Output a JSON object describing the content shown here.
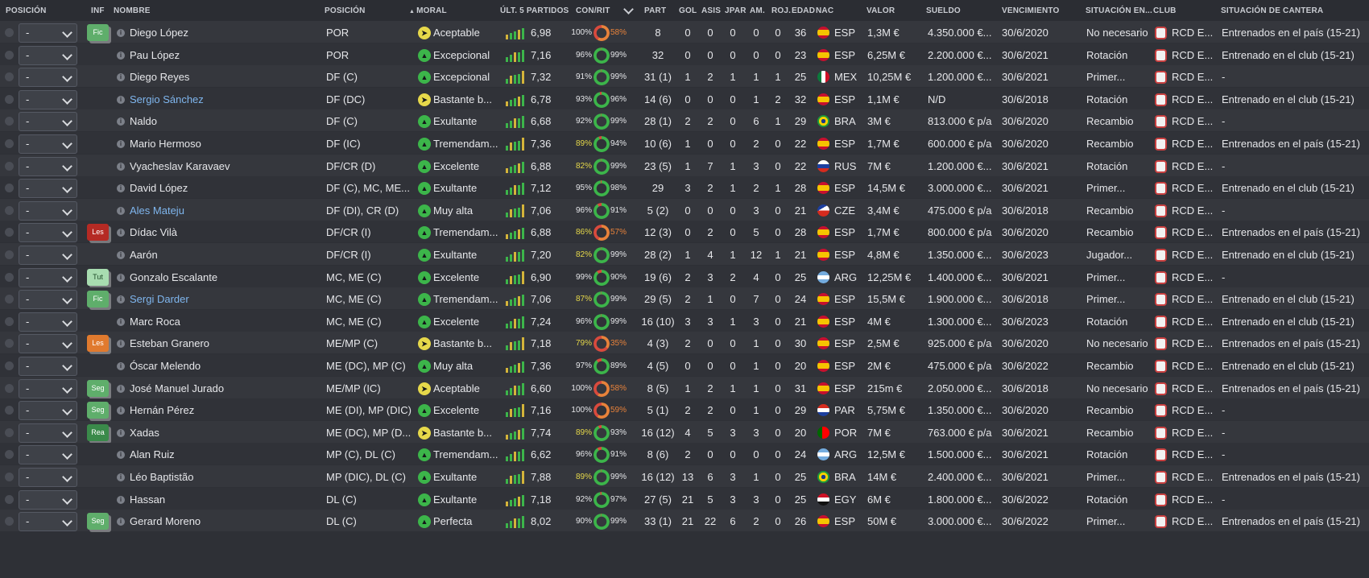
{
  "headers": {
    "posicion": "POSICIÓN",
    "inf": "INF",
    "nombre": "NOMBRE",
    "posicion2": "POSICIÓN",
    "moral": "MORAL",
    "ult5": "ÚLT. 5 PARTIDOS",
    "conrit": "CON/RIT",
    "part": "PART",
    "gol": "GOL",
    "asis": "ASIS",
    "jpar": "JPAR",
    "am": "AM.",
    "roj": "ROJ.",
    "edad": "EDAD",
    "nac": "NAC",
    "valor": "VALOR",
    "sueldo": "SUELDO",
    "vencimiento": "VENCIMIENTO",
    "situacion": "SITUACIÓN EN...",
    "club": "CLUB",
    "cantera": "SITUACIÓN DE CANTERA"
  },
  "colors": {
    "green": "#3cb54a",
    "orange": "#e8823a",
    "yellow": "#e6d84a",
    "red": "#d94a3d"
  },
  "players": [
    {
      "sel": "-",
      "badge": "Fic",
      "badge_color": "#5fae6b",
      "name": "Diego López",
      "link": false,
      "pos": "POR",
      "moral_icon": "yellow",
      "moral": "Aceptable",
      "avg": "6,98",
      "cond": "100%",
      "rit": "58%",
      "rit_color": "orange",
      "part": "8",
      "gol": "0",
      "asis": "0",
      "jpar": "0",
      "am": "0",
      "roj": "0",
      "edad": "36",
      "nac": "ESP",
      "valor": "1,3M €",
      "sueldo": "4.350.000 €...",
      "venc": "30/6/2020",
      "sit": "No necesario",
      "club": "RCD E...",
      "cantera": "Entrenados en el país (15-21)"
    },
    {
      "sel": "-",
      "badge": "",
      "badge_color": "",
      "name": "Pau López",
      "link": false,
      "pos": "POR",
      "moral_icon": "green",
      "moral": "Excepcional",
      "avg": "7,16",
      "cond": "96%",
      "rit": "99%",
      "rit_color": "green",
      "part": "32",
      "gol": "0",
      "asis": "0",
      "jpar": "0",
      "am": "0",
      "roj": "0",
      "edad": "23",
      "nac": "ESP",
      "valor": "6,25M €",
      "sueldo": "2.200.000 €...",
      "venc": "30/6/2021",
      "sit": "Rotación",
      "club": "RCD E...",
      "cantera": "Entrenado en el club (15-21)"
    },
    {
      "sel": "-",
      "badge": "",
      "badge_color": "",
      "name": "Diego Reyes",
      "link": false,
      "pos": "DF (C)",
      "moral_icon": "green",
      "moral": "Excepcional",
      "avg": "7,32",
      "cond": "91%",
      "rit": "99%",
      "rit_color": "green",
      "part": "31 (1)",
      "gol": "1",
      "asis": "2",
      "jpar": "1",
      "am": "1",
      "roj": "1",
      "edad": "25",
      "nac": "MEX",
      "valor": "10,25M €",
      "sueldo": "1.200.000 €...",
      "venc": "30/6/2021",
      "sit": "Primer...",
      "club": "RCD E...",
      "cantera": "-"
    },
    {
      "sel": "-",
      "badge": "",
      "badge_color": "",
      "name": "Sergio Sánchez",
      "link": true,
      "pos": "DF (DC)",
      "moral_icon": "yellow",
      "moral": "Bastante b...",
      "avg": "6,78",
      "cond": "93%",
      "rit": "96%",
      "rit_color": "green",
      "part": "14 (6)",
      "gol": "0",
      "asis": "0",
      "jpar": "0",
      "am": "1",
      "roj": "2",
      "edad": "32",
      "nac": "ESP",
      "valor": "1,1M €",
      "sueldo": "N/D",
      "venc": "30/6/2018",
      "sit": "Rotación",
      "club": "RCD E...",
      "cantera": "Entrenado en el club (15-21)"
    },
    {
      "sel": "-",
      "badge": "",
      "badge_color": "",
      "name": "Naldo",
      "link": false,
      "pos": "DF (C)",
      "moral_icon": "green",
      "moral": "Exultante",
      "avg": "6,68",
      "cond": "92%",
      "rit": "99%",
      "rit_color": "green",
      "part": "28 (1)",
      "gol": "2",
      "asis": "2",
      "jpar": "0",
      "am": "6",
      "roj": "1",
      "edad": "29",
      "nac": "BRA",
      "valor": "3M €",
      "sueldo": "813.000 € p/a",
      "venc": "30/6/2020",
      "sit": "Recambio",
      "club": "RCD E...",
      "cantera": "-"
    },
    {
      "sel": "-",
      "badge": "",
      "badge_color": "",
      "name": "Mario Hermoso",
      "link": false,
      "pos": "DF (IC)",
      "moral_icon": "green",
      "moral": "Tremendam...",
      "avg": "7,36",
      "cond": "89%",
      "rit": "94%",
      "rit_color": "green",
      "part": "10 (6)",
      "gol": "1",
      "asis": "0",
      "jpar": "0",
      "am": "2",
      "roj": "0",
      "edad": "22",
      "nac": "ESP",
      "valor": "1,7M €",
      "sueldo": "600.000 € p/a",
      "venc": "30/6/2020",
      "sit": "Recambio",
      "club": "RCD E...",
      "cantera": "Entrenados en el país (15-21)"
    },
    {
      "sel": "-",
      "badge": "",
      "badge_color": "",
      "name": "Vyacheslav Karavaev",
      "link": false,
      "pos": "DF/CR (D)",
      "moral_icon": "green",
      "moral": "Excelente",
      "avg": "6,88",
      "cond": "82%",
      "rit": "99%",
      "rit_color": "green",
      "part": "23 (5)",
      "gol": "1",
      "asis": "7",
      "jpar": "1",
      "am": "3",
      "roj": "0",
      "edad": "22",
      "nac": "RUS",
      "valor": "7M €",
      "sueldo": "1.200.000 €...",
      "venc": "30/6/2021",
      "sit": "Rotación",
      "club": "RCD E...",
      "cantera": "-"
    },
    {
      "sel": "-",
      "badge": "",
      "badge_color": "",
      "name": "David López",
      "link": false,
      "pos": "DF (C), MC, ME...",
      "moral_icon": "green",
      "moral": "Exultante",
      "avg": "7,12",
      "cond": "95%",
      "rit": "98%",
      "rit_color": "green",
      "part": "29",
      "gol": "3",
      "asis": "2",
      "jpar": "1",
      "am": "2",
      "roj": "1",
      "edad": "28",
      "nac": "ESP",
      "valor": "14,5M €",
      "sueldo": "3.000.000 €...",
      "venc": "30/6/2021",
      "sit": "Primer...",
      "club": "RCD E...",
      "cantera": "Entrenado en el club (15-21)"
    },
    {
      "sel": "-",
      "badge": "",
      "badge_color": "",
      "name": "Ales Mateju",
      "link": true,
      "pos": "DF (DI), CR (D)",
      "moral_icon": "green",
      "moral": "Muy alta",
      "avg": "7,06",
      "cond": "96%",
      "rit": "91%",
      "rit_color": "green",
      "part": "5 (2)",
      "gol": "0",
      "asis": "0",
      "jpar": "0",
      "am": "3",
      "roj": "0",
      "edad": "21",
      "nac": "CZE",
      "valor": "3,4M €",
      "sueldo": "475.000 € p/a",
      "venc": "30/6/2018",
      "sit": "Recambio",
      "club": "RCD E...",
      "cantera": "-"
    },
    {
      "sel": "-",
      "badge": "Les",
      "badge_color": "#b52a24",
      "name": "Dídac Vilà",
      "link": false,
      "pos": "DF/CR (I)",
      "moral_icon": "green",
      "moral": "Tremendam...",
      "avg": "6,88",
      "cond": "86%",
      "rit": "57%",
      "rit_color": "orange",
      "part": "12 (3)",
      "gol": "0",
      "asis": "2",
      "jpar": "0",
      "am": "5",
      "roj": "0",
      "edad": "28",
      "nac": "ESP",
      "valor": "1,7M €",
      "sueldo": "800.000 € p/a",
      "venc": "30/6/2020",
      "sit": "Recambio",
      "club": "RCD E...",
      "cantera": "Entrenados en el país (15-21)"
    },
    {
      "sel": "-",
      "badge": "",
      "badge_color": "",
      "name": "Aarón",
      "link": false,
      "pos": "DF/CR (I)",
      "moral_icon": "green",
      "moral": "Exultante",
      "avg": "7,20",
      "cond": "82%",
      "rit": "99%",
      "rit_color": "green",
      "part": "28 (2)",
      "gol": "1",
      "asis": "4",
      "jpar": "1",
      "am": "12",
      "roj": "1",
      "edad": "21",
      "nac": "ESP",
      "valor": "4,8M €",
      "sueldo": "1.350.000 €...",
      "venc": "30/6/2023",
      "sit": "Jugador...",
      "club": "RCD E...",
      "cantera": "Entrenado en el club (15-21)"
    },
    {
      "sel": "-",
      "badge": "Tut",
      "badge_color": "#a8dcb0",
      "name": "Gonzalo Escalante",
      "link": false,
      "pos": "MC, ME (C)",
      "moral_icon": "green",
      "moral": "Excelente",
      "avg": "6,90",
      "cond": "99%",
      "rit": "90%",
      "rit_color": "green",
      "part": "19 (6)",
      "gol": "2",
      "asis": "3",
      "jpar": "2",
      "am": "4",
      "roj": "0",
      "edad": "25",
      "nac": "ARG",
      "valor": "12,25M €",
      "sueldo": "1.400.000 €...",
      "venc": "30/6/2021",
      "sit": "Primer...",
      "club": "RCD E...",
      "cantera": "-"
    },
    {
      "sel": "-",
      "badge": "Fic",
      "badge_color": "#5fae6b",
      "name": "Sergi Darder",
      "link": true,
      "pos": "MC, ME (C)",
      "moral_icon": "green",
      "moral": "Tremendam...",
      "avg": "7,06",
      "cond": "87%",
      "rit": "99%",
      "rit_color": "green",
      "part": "29 (5)",
      "gol": "2",
      "asis": "1",
      "jpar": "0",
      "am": "7",
      "roj": "0",
      "edad": "24",
      "nac": "ESP",
      "valor": "15,5M €",
      "sueldo": "1.900.000 €...",
      "venc": "30/6/2018",
      "sit": "Primer...",
      "club": "RCD E...",
      "cantera": "Entrenado en el club (15-21)"
    },
    {
      "sel": "-",
      "badge": "",
      "badge_color": "",
      "name": "Marc Roca",
      "link": false,
      "pos": "MC, ME (C)",
      "moral_icon": "green",
      "moral": "Excelente",
      "avg": "7,24",
      "cond": "96%",
      "rit": "99%",
      "rit_color": "green",
      "part": "16 (10)",
      "gol": "3",
      "asis": "3",
      "jpar": "1",
      "am": "3",
      "roj": "0",
      "edad": "21",
      "nac": "ESP",
      "valor": "4M €",
      "sueldo": "1.300.000 €...",
      "venc": "30/6/2023",
      "sit": "Rotación",
      "club": "RCD E...",
      "cantera": "Entrenado en el club (15-21)"
    },
    {
      "sel": "-",
      "badge": "Les",
      "badge_color": "#e07a2e",
      "name": "Esteban Granero",
      "link": false,
      "pos": "ME/MP (C)",
      "moral_icon": "yellow",
      "moral": "Bastante b...",
      "avg": "7,18",
      "cond": "79%",
      "rit": "35%",
      "rit_color": "orange",
      "part": "4 (3)",
      "gol": "2",
      "asis": "0",
      "jpar": "0",
      "am": "1",
      "roj": "0",
      "edad": "30",
      "nac": "ESP",
      "valor": "2,5M €",
      "sueldo": "925.000 € p/a",
      "venc": "30/6/2020",
      "sit": "No necesario",
      "club": "RCD E...",
      "cantera": "Entrenados en el país (15-21)"
    },
    {
      "sel": "-",
      "badge": "",
      "badge_color": "",
      "name": "Óscar Melendo",
      "link": false,
      "pos": "ME (DC), MP (C)",
      "moral_icon": "green",
      "moral": "Muy alta",
      "avg": "7,36",
      "cond": "97%",
      "rit": "89%",
      "rit_color": "green",
      "part": "4 (5)",
      "gol": "0",
      "asis": "0",
      "jpar": "0",
      "am": "1",
      "roj": "0",
      "edad": "20",
      "nac": "ESP",
      "valor": "2M €",
      "sueldo": "475.000 € p/a",
      "venc": "30/6/2022",
      "sit": "Recambio",
      "club": "RCD E...",
      "cantera": "Entrenado en el club (15-21)"
    },
    {
      "sel": "-",
      "badge": "Seg",
      "badge_color": "#5fae6b",
      "name": "José Manuel Jurado",
      "link": false,
      "pos": "ME/MP (IC)",
      "moral_icon": "yellow",
      "moral": "Aceptable",
      "avg": "6,60",
      "cond": "100%",
      "rit": "58%",
      "rit_color": "orange",
      "part": "8 (5)",
      "gol": "1",
      "asis": "2",
      "jpar": "1",
      "am": "1",
      "roj": "0",
      "edad": "31",
      "nac": "ESP",
      "valor": "215m €",
      "sueldo": "2.050.000 €...",
      "venc": "30/6/2018",
      "sit": "No necesario",
      "club": "RCD E...",
      "cantera": "Entrenados en el país (15-21)"
    },
    {
      "sel": "-",
      "badge": "Seg",
      "badge_color": "#5fae6b",
      "name": "Hernán Pérez",
      "link": false,
      "pos": "ME (DI), MP (DIC)",
      "moral_icon": "green",
      "moral": "Excelente",
      "avg": "7,16",
      "cond": "100%",
      "rit": "59%",
      "rit_color": "orange",
      "part": "5 (1)",
      "gol": "2",
      "asis": "2",
      "jpar": "0",
      "am": "1",
      "roj": "0",
      "edad": "29",
      "nac": "PAR",
      "valor": "5,75M €",
      "sueldo": "1.350.000 €...",
      "venc": "30/6/2020",
      "sit": "Recambio",
      "club": "RCD E...",
      "cantera": "-"
    },
    {
      "sel": "-",
      "badge": "Rea",
      "badge_color": "#3a8a4a",
      "name": "Xadas",
      "link": false,
      "pos": "ME (DC), MP (D...",
      "moral_icon": "yellow",
      "moral": "Bastante b...",
      "avg": "7,74",
      "cond": "89%",
      "rit": "93%",
      "rit_color": "green",
      "part": "16 (12)",
      "gol": "4",
      "asis": "5",
      "jpar": "3",
      "am": "3",
      "roj": "0",
      "edad": "20",
      "nac": "POR",
      "valor": "7M €",
      "sueldo": "763.000 € p/a",
      "venc": "30/6/2021",
      "sit": "Recambio",
      "club": "RCD E...",
      "cantera": "-"
    },
    {
      "sel": "-",
      "badge": "",
      "badge_color": "",
      "name": "Alan Ruiz",
      "link": false,
      "pos": "MP (C), DL (C)",
      "moral_icon": "green",
      "moral": "Tremendam...",
      "avg": "6,62",
      "cond": "96%",
      "rit": "91%",
      "rit_color": "green",
      "part": "8 (6)",
      "gol": "2",
      "asis": "0",
      "jpar": "0",
      "am": "0",
      "roj": "0",
      "edad": "24",
      "nac": "ARG",
      "valor": "12,5M €",
      "sueldo": "1.500.000 €...",
      "venc": "30/6/2021",
      "sit": "Rotación",
      "club": "RCD E...",
      "cantera": "-"
    },
    {
      "sel": "-",
      "badge": "",
      "badge_color": "",
      "name": "Léo Baptistão",
      "link": false,
      "pos": "MP (DIC), DL (C)",
      "moral_icon": "green",
      "moral": "Exultante",
      "avg": "7,88",
      "cond": "89%",
      "rit": "99%",
      "rit_color": "green",
      "part": "16 (12)",
      "gol": "13",
      "asis": "6",
      "jpar": "3",
      "am": "1",
      "roj": "0",
      "edad": "25",
      "nac": "BRA",
      "valor": "14M €",
      "sueldo": "2.400.000 €...",
      "venc": "30/6/2021",
      "sit": "Primer...",
      "club": "RCD E...",
      "cantera": "Entrenados en el país (15-21)"
    },
    {
      "sel": "-",
      "badge": "",
      "badge_color": "",
      "name": "Hassan",
      "link": false,
      "pos": "DL (C)",
      "moral_icon": "green",
      "moral": "Exultante",
      "avg": "7,18",
      "cond": "92%",
      "rit": "97%",
      "rit_color": "green",
      "part": "27 (5)",
      "gol": "21",
      "asis": "5",
      "jpar": "3",
      "am": "3",
      "roj": "0",
      "edad": "25",
      "nac": "EGY",
      "valor": "6M €",
      "sueldo": "1.800.000 €...",
      "venc": "30/6/2022",
      "sit": "Rotación",
      "club": "RCD E...",
      "cantera": "-"
    },
    {
      "sel": "-",
      "badge": "Seg",
      "badge_color": "#5fae6b",
      "name": "Gerard Moreno",
      "link": false,
      "pos": "DL (C)",
      "moral_icon": "green",
      "moral": "Perfecta",
      "avg": "8,02",
      "cond": "90%",
      "rit": "99%",
      "rit_color": "green",
      "part": "33 (1)",
      "gol": "21",
      "asis": "22",
      "jpar": "6",
      "am": "2",
      "roj": "0",
      "edad": "26",
      "nac": "ESP",
      "valor": "50M €",
      "sueldo": "3.000.000 €...",
      "venc": "30/6/2022",
      "sit": "Primer...",
      "club": "RCD E...",
      "cantera": "Entrenados en el país (15-21)"
    }
  ]
}
